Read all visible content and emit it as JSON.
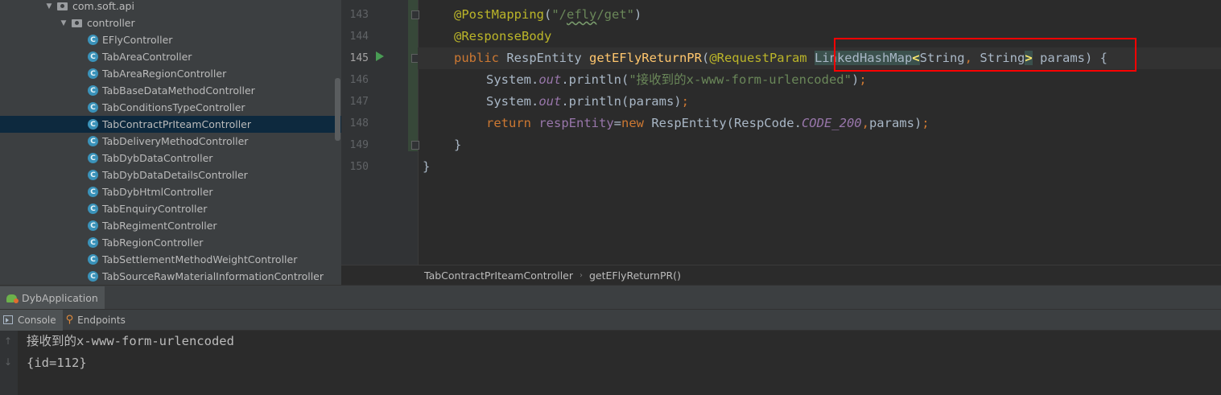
{
  "project_tree": {
    "package": "com.soft.api",
    "folder": "controller",
    "class_icon_letter": "C",
    "classes": [
      "EFlyController",
      "TabAreaController",
      "TabAreaRegionController",
      "TabBaseDataMethodController",
      "TabConditionsTypeController",
      "TabContractPrIteamController",
      "TabDeliveryMethodController",
      "TabDybDataController",
      "TabDybDataDetailsController",
      "TabDybHtmlController",
      "TabEnquiryController",
      "TabRegimentController",
      "TabRegionController",
      "TabSettlementMethodWeightController",
      "TabSourceRawMaterialInformationController"
    ],
    "selected": "TabContractPrIteamController"
  },
  "editor": {
    "line_numbers": [
      "143",
      "144",
      "145",
      "146",
      "147",
      "148",
      "149",
      "150"
    ],
    "current_line": "145",
    "lines": {
      "l143": {
        "a1": "@PostMapping",
        "p1": "(",
        "s1": "\"/",
        "s2": "efly",
        "s3": "/get\"",
        "p2": ")"
      },
      "l144": {
        "a1": "@ResponseBody"
      },
      "l145": {
        "k1": "public ",
        "t1": "RespEntity ",
        "f1": "getEFlyReturnPR",
        "p1": "(",
        "a1": "@RequestParam ",
        "t2": "LinkedHashMap",
        "b1": "<",
        "t3": "String",
        "c1": ", ",
        "t4": "String",
        "b2": ">",
        "v1": " params",
        "p2": ") {"
      },
      "l146": {
        "t1": "System.",
        "f1": "out",
        "t2": ".println(",
        "s1": "\"接收到的x-www-form-urlencoded\"",
        "t3": ")",
        "c1": ";"
      },
      "l147": {
        "t1": "System.",
        "f1": "out",
        "t2": ".println(params)",
        "c1": ";"
      },
      "l148": {
        "k1": "return ",
        "v1": "respEntity",
        "t1": "=",
        "k2": "new ",
        "t2": "RespEntity(RespCode.",
        "f1": "CODE_200",
        "c1": ",",
        "t3": "params)",
        "c2": ";"
      },
      "l149": {
        "t1": "}"
      },
      "l150": {
        "t1": "}"
      }
    }
  },
  "breadcrumb": {
    "items": [
      "TabContractPrIteamController",
      "getEFlyReturnPR()"
    ],
    "separator": "›"
  },
  "run_window": {
    "tab_label": "DybApplication",
    "sub_tabs": [
      "Console",
      "Endpoints"
    ],
    "console_lines": [
      "接收到的x-www-form-urlencoded",
      "{id=112}"
    ],
    "scroll_up": "↑",
    "scroll_down": "↓"
  },
  "colors": {
    "annotation": "#bbb529",
    "string": "#6a8759",
    "keyword": "#cc7832",
    "method": "#ffc66d",
    "field": "#9876aa",
    "highlight_box": "#ff0000"
  }
}
